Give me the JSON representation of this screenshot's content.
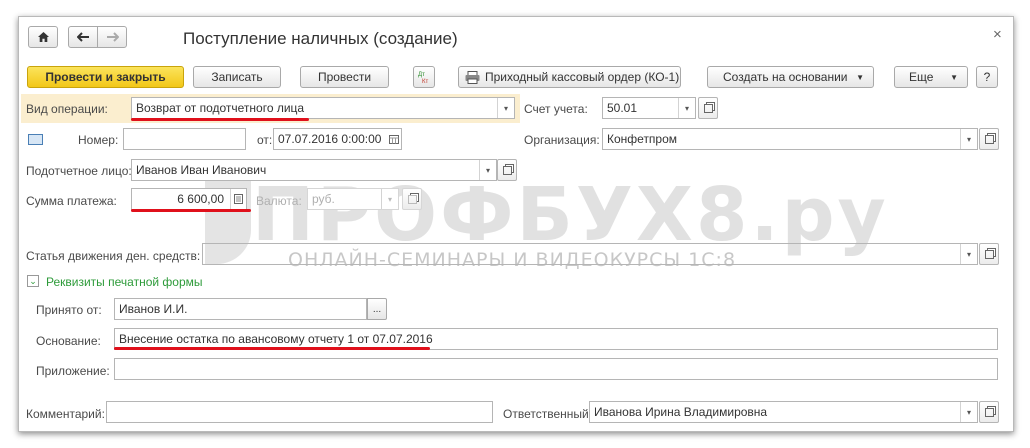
{
  "window": {
    "title": "Поступление наличных (создание)",
    "close": "×"
  },
  "toolbar": {
    "post_close": "Провести и закрыть",
    "save": "Записать",
    "post": "Провести",
    "dtkt": "Дт\nКт",
    "print_order": "Приходный кассовый ордер (КО-1)",
    "create_based": "Создать на основании",
    "more": "Еще",
    "help": "?"
  },
  "form": {
    "operation_label": "Вид операции:",
    "operation_value": "Возврат от подотчетного лица",
    "account_label": "Счет учета:",
    "account_value": "50.01",
    "number_label": "Номер:",
    "number_value": "",
    "date_label": "от:",
    "date_value": "07.07.2016  0:00:00",
    "org_label": "Организация:",
    "org_value": "Конфетпром",
    "person_label": "Подотчетное лицо:",
    "person_value": "Иванов Иван Иванович",
    "amount_label": "Сумма платежа:",
    "amount_value": "6 600,00",
    "currency_label": "Валюта:",
    "currency_value": "руб.",
    "cashflow_label": "Статья движения ден. средств:",
    "cashflow_value": "",
    "print_section": "Реквизиты печатной формы",
    "received_label": "Принято от:",
    "received_value": "Иванов И.И.",
    "basis_label": "Основание:",
    "basis_value": "Внесение остатка по авансовому отчету 1 от 07.07.2016",
    "attachment_label": "Приложение:",
    "attachment_value": "",
    "comment_label": "Комментарий:",
    "comment_value": "",
    "responsible_label": "Ответственный:",
    "responsible_value": "Иванова Ирина Владимировна"
  },
  "watermark": {
    "title": "ПРОФБУХ8.ру",
    "subtitle": "ОНЛАЙН-СЕМИНАРЫ И ВИДЕОКУРСЫ 1С:8"
  },
  "colors": {
    "accent": "#f2c718",
    "annotation": "#e0101b",
    "section": "#2e9b3a"
  }
}
